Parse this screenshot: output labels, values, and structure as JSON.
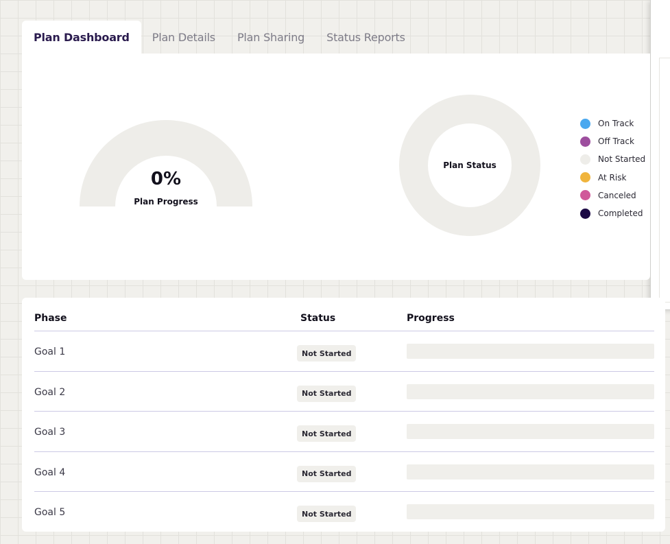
{
  "tabs": [
    {
      "label": "Plan Dashboard",
      "active": true
    },
    {
      "label": "Plan Details",
      "active": false
    },
    {
      "label": "Plan Sharing",
      "active": false
    },
    {
      "label": "Status Reports",
      "active": false
    }
  ],
  "dashboard": {
    "progress": {
      "value_text": "0%",
      "fraction": 0,
      "label": "Plan Progress"
    },
    "status_chart": {
      "label": "Plan Status"
    },
    "legend": [
      {
        "label": "On Track",
        "color": "#4aa8ef"
      },
      {
        "label": "Off Track",
        "color": "#9d4e9e"
      },
      {
        "label": "Not Started",
        "color": "#eeede9"
      },
      {
        "label": "At Risk",
        "color": "#f0b43c"
      },
      {
        "label": "Canceled",
        "color": "#d0589a"
      },
      {
        "label": "Completed",
        "color": "#1c0a45"
      }
    ]
  },
  "table": {
    "headers": {
      "phase": "Phase",
      "status": "Status",
      "progress": "Progress"
    },
    "rows": [
      {
        "phase": "Goal 1",
        "status": "Not Started",
        "progress": 0
      },
      {
        "phase": "Goal 2",
        "status": "Not Started",
        "progress": 0
      },
      {
        "phase": "Goal 3",
        "status": "Not Started",
        "progress": 0
      },
      {
        "phase": "Goal 4",
        "status": "Not Started",
        "progress": 0
      },
      {
        "phase": "Goal 5",
        "status": "Not Started",
        "progress": 0
      }
    ]
  },
  "colors": {
    "track": "#eeede9",
    "progress_fill": "#4aa8ef",
    "accent": "#2a1b4e"
  }
}
